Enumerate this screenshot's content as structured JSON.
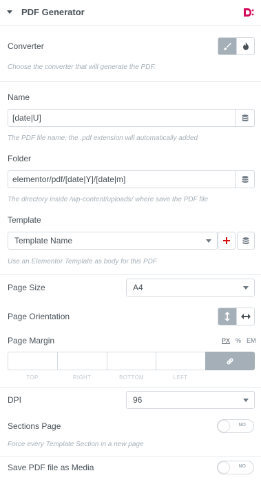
{
  "header": {
    "title": "PDF Generator",
    "brand_icon": "dynamic-content-logo-icon",
    "brand_color": "#d30c5c"
  },
  "converter": {
    "label": "Converter",
    "options": [
      {
        "icon": "brush-icon",
        "active": true
      },
      {
        "icon": "fire-icon",
        "active": false
      }
    ],
    "description": "Choose the converter that will generate the PDF."
  },
  "name": {
    "label": "Name",
    "value": "[date|U]",
    "description": "The PDF file name, the .pdf extension will automatically added"
  },
  "folder": {
    "label": "Folder",
    "value": "elementor/pdf/[date|Y]/[date|m]",
    "description": "The directory inside /wp-content/uploads/ where save the PDF file"
  },
  "template": {
    "label": "Template",
    "value": "Template Name",
    "description": "Use an Elementor Template as body for this PDF"
  },
  "page_size": {
    "label": "Page Size",
    "value": "A4"
  },
  "page_orientation": {
    "label": "Page Orientation",
    "options": [
      {
        "icon": "vertical-arrows-icon",
        "active": true
      },
      {
        "icon": "horizontal-arrows-icon",
        "active": false
      }
    ]
  },
  "page_margin": {
    "label": "Page Margin",
    "units": [
      "PX",
      "%",
      "EM"
    ],
    "active_unit": "PX",
    "fields": [
      "TOP",
      "RIGHT",
      "BOTTOM",
      "LEFT"
    ]
  },
  "dpi": {
    "label": "DPI",
    "value": "96"
  },
  "sections_page": {
    "label": "Sections Page",
    "toggle": "NO",
    "description": "Force every Template Section in a new page"
  },
  "save_media": {
    "label": "Save PDF file as Media",
    "toggle": "NO"
  },
  "colors": {
    "accent": "#a4afb7",
    "text": "#495157",
    "muted": "#a4afb7",
    "border": "#d5dadf",
    "add": "#d30c0c"
  }
}
